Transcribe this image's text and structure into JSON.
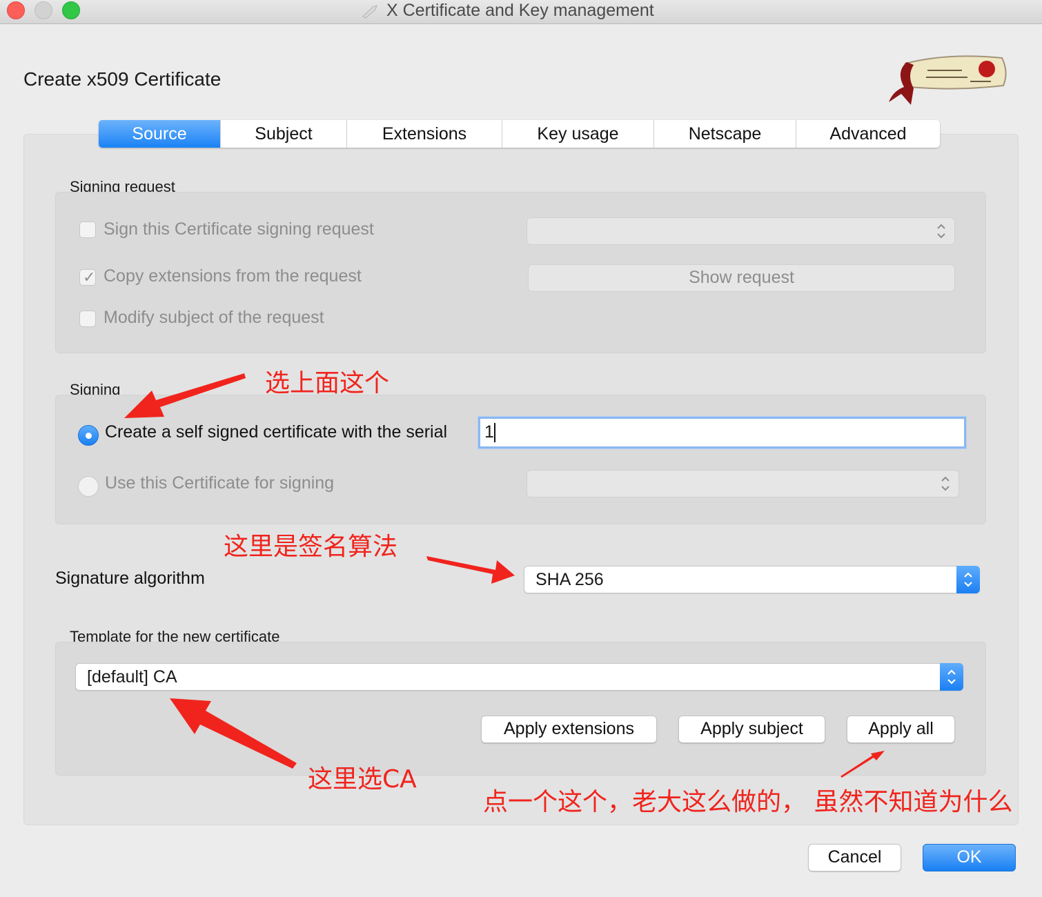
{
  "window": {
    "title": "X Certificate and Key management"
  },
  "dialog": {
    "title": "Create x509 Certificate",
    "logo_icon": "scroll-logo-icon"
  },
  "tabs": [
    {
      "label": "Source",
      "active": true
    },
    {
      "label": "Subject"
    },
    {
      "label": "Extensions"
    },
    {
      "label": "Key usage"
    },
    {
      "label": "Netscape"
    },
    {
      "label": "Advanced"
    }
  ],
  "signing_request": {
    "group_label": "Signing request",
    "sign_csr": {
      "label": "Sign this Certificate signing request",
      "checked": false
    },
    "copy_extensions": {
      "label": "Copy extensions from the request",
      "checked": true
    },
    "modify_subject": {
      "label": "Modify subject of the request",
      "checked": false
    },
    "request_select": {
      "value": ""
    },
    "show_request_label": "Show request"
  },
  "signing": {
    "group_label": "Signing",
    "self_signed": {
      "label": "Create a self signed certificate with the serial",
      "selected": true
    },
    "serial_value": "1",
    "use_cert": {
      "label": "Use this Certificate for signing",
      "selected": false
    },
    "cert_select": {
      "value": ""
    }
  },
  "signature_algorithm": {
    "label": "Signature algorithm",
    "value": "SHA 256"
  },
  "template": {
    "group_label": "Template for the new certificate",
    "value": "[default] CA",
    "apply_extensions_label": "Apply extensions",
    "apply_subject_label": "Apply subject",
    "apply_all_label": "Apply all"
  },
  "footer": {
    "cancel_label": "Cancel",
    "ok_label": "OK"
  },
  "annotations": {
    "select_above": "选上面这个",
    "sig_algo_note": "这里是签名算法",
    "select_ca": "这里选CA",
    "apply_all_note": "点一个这个，老大这么做的， 虽然不知道为什么"
  },
  "colors": {
    "accent": "#1a82f6",
    "annotation": "#f0241d",
    "background": "#ececec"
  }
}
